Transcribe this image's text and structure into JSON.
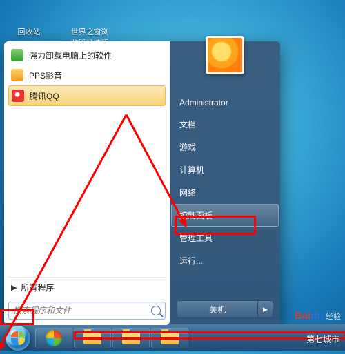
{
  "desktop": {
    "icons": [
      {
        "label": "回收站"
      },
      {
        "label": "世界之窗浏览器极速版"
      }
    ]
  },
  "start_menu": {
    "programs": [
      {
        "label": "强力卸载电脑上的软件",
        "icon": "uninstall-icon"
      },
      {
        "label": "PPS影音",
        "icon": "pps-icon"
      },
      {
        "label": "腾讯QQ",
        "icon": "qq-icon",
        "highlighted": true
      }
    ],
    "all_programs_label": "所有程序",
    "search_placeholder": "搜索程序和文件",
    "right": {
      "user": "Administrator",
      "links": [
        "文档",
        "游戏",
        "计算机",
        "网络",
        "控制面板",
        "管理工具",
        "运行..."
      ],
      "shutdown_label": "关机"
    }
  },
  "watermark": {
    "brand_left": "Bai",
    "brand_right": "du",
    "sub": "经验",
    "site": "第七城市"
  }
}
